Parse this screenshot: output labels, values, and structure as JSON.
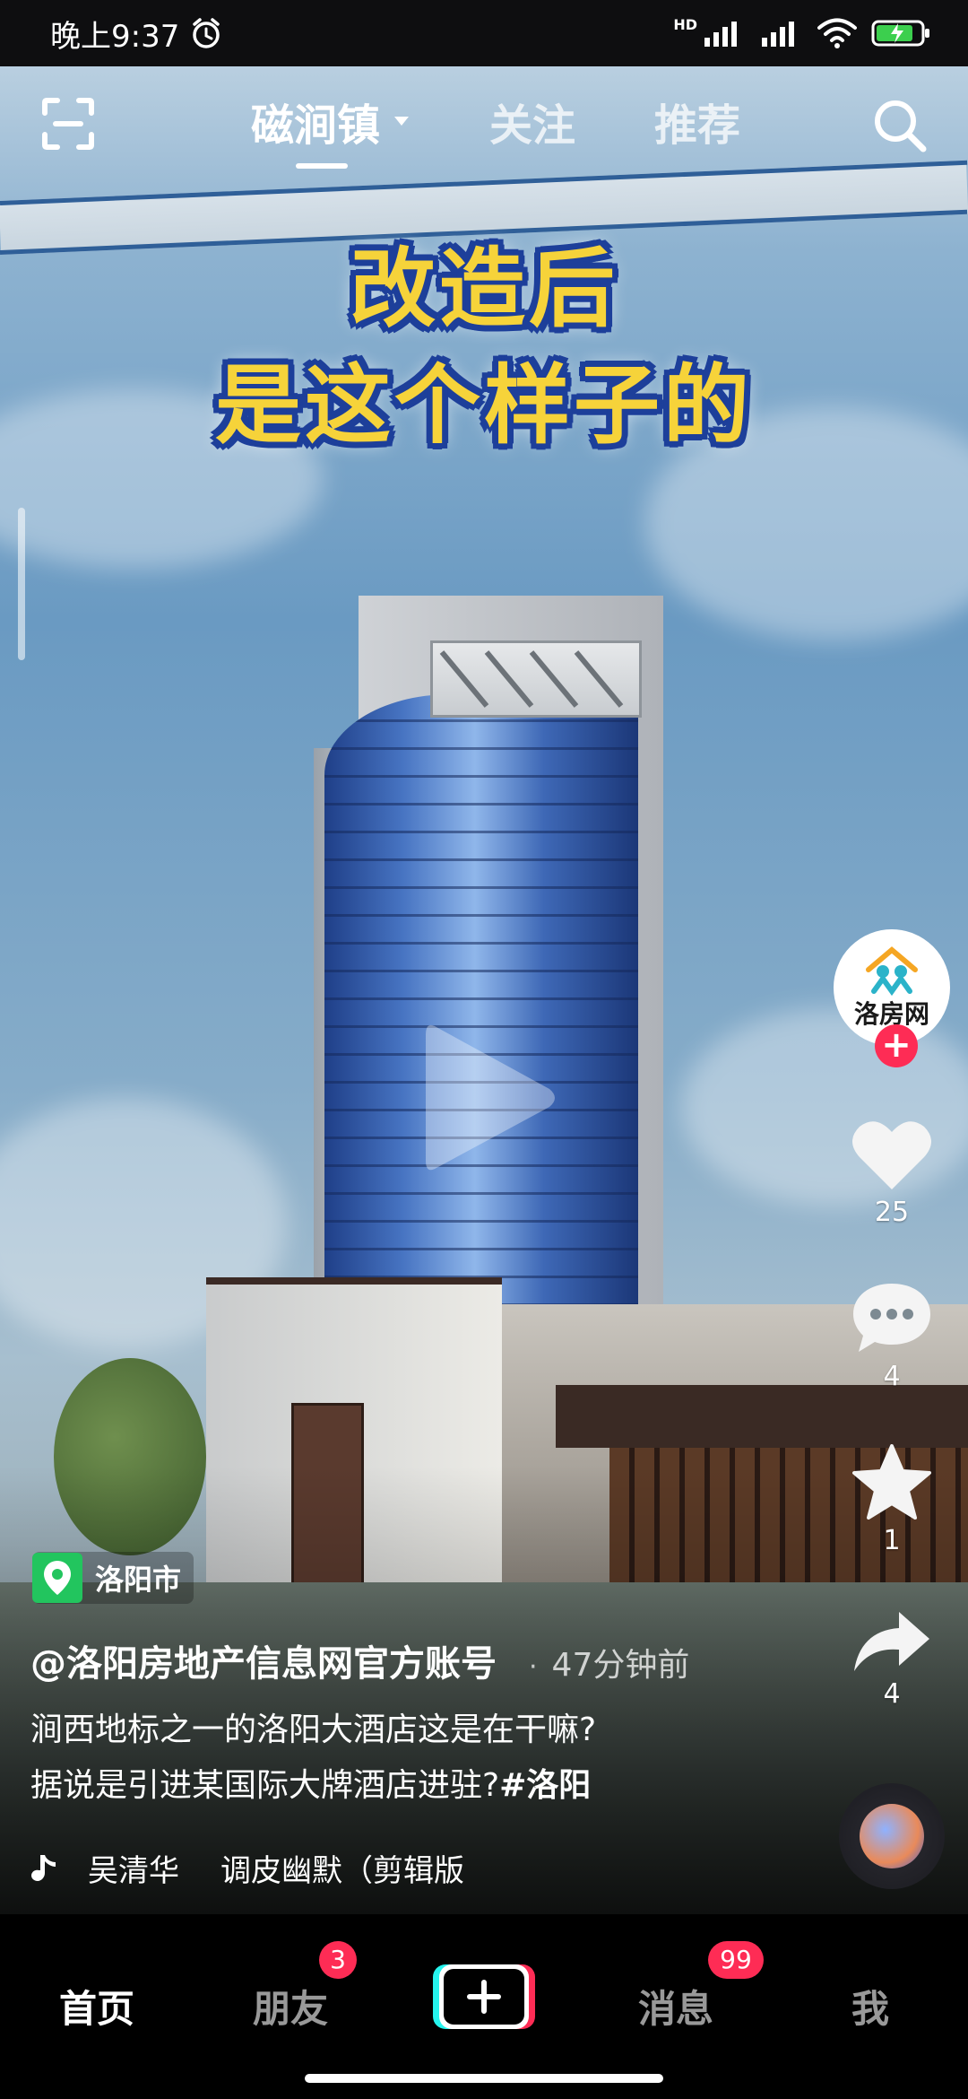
{
  "status_bar": {
    "time": "晚上9:37",
    "network": "HD"
  },
  "top_nav": {
    "tabs": [
      {
        "label": "磁涧镇",
        "active": true
      },
      {
        "label": "关注",
        "active": false
      },
      {
        "label": "推荐",
        "active": false
      }
    ]
  },
  "video": {
    "overlay_line1": "改造后",
    "overlay_line2": "是这个样子的"
  },
  "creator": {
    "avatar_text": "洛房网"
  },
  "actions": {
    "likes": "25",
    "comments": "4",
    "favorites": "1",
    "shares": "4"
  },
  "post": {
    "location": "洛阳市",
    "author": "@洛阳房地产信息网官方账号",
    "time_ago": "47分钟前",
    "desc_line1": "涧西地标之一的洛阳大酒店这是在干嘛?",
    "desc_line2": "据说是引进某国际大牌酒店进驻?",
    "hashtag": "#洛阳"
  },
  "music": {
    "artist": "吴清华",
    "title": "调皮幽默（剪辑版"
  },
  "bottom_nav": {
    "items": [
      {
        "label": "首页",
        "active": true
      },
      {
        "label": "朋友",
        "badge": "3"
      },
      {
        "label": "消息",
        "badge": "99"
      },
      {
        "label": "我"
      }
    ]
  },
  "colors": {
    "accent": "#fe2c55",
    "location_green": "#22c55e",
    "overlay_text": "#f6d33a",
    "overlay_outline": "#1d3f9a"
  }
}
